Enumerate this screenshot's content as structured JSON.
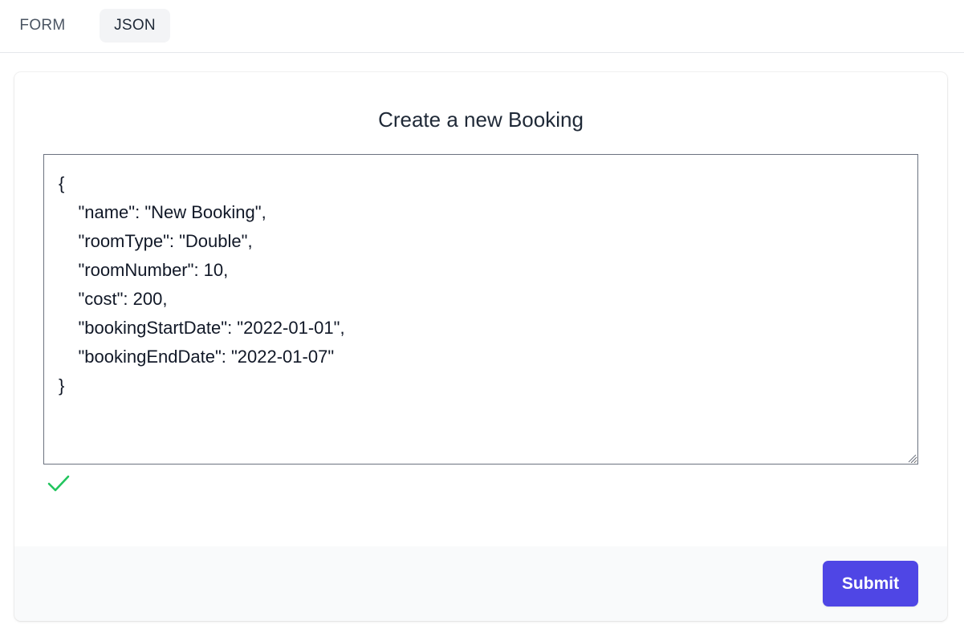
{
  "tabs": [
    {
      "label": "FORM",
      "active": false
    },
    {
      "label": "JSON",
      "active": true
    }
  ],
  "card": {
    "title": "Create a new Booking",
    "editor": {
      "value": "{\n    \"name\": \"New Booking\",\n    \"roomType\": \"Double\",\n    \"roomNumber\": 10,\n    \"cost\": 200,\n    \"bookingStartDate\": \"2022-01-01\",\n    \"bookingEndDate\": \"2022-01-07\"\n}"
    },
    "validation_icon": "check-icon",
    "validation_color": "#22c55e",
    "submit_label": "Submit"
  },
  "colors": {
    "accent": "#4f46e5",
    "active_tab_bg": "#f3f4f6",
    "footer_bg": "#f9fafb"
  }
}
